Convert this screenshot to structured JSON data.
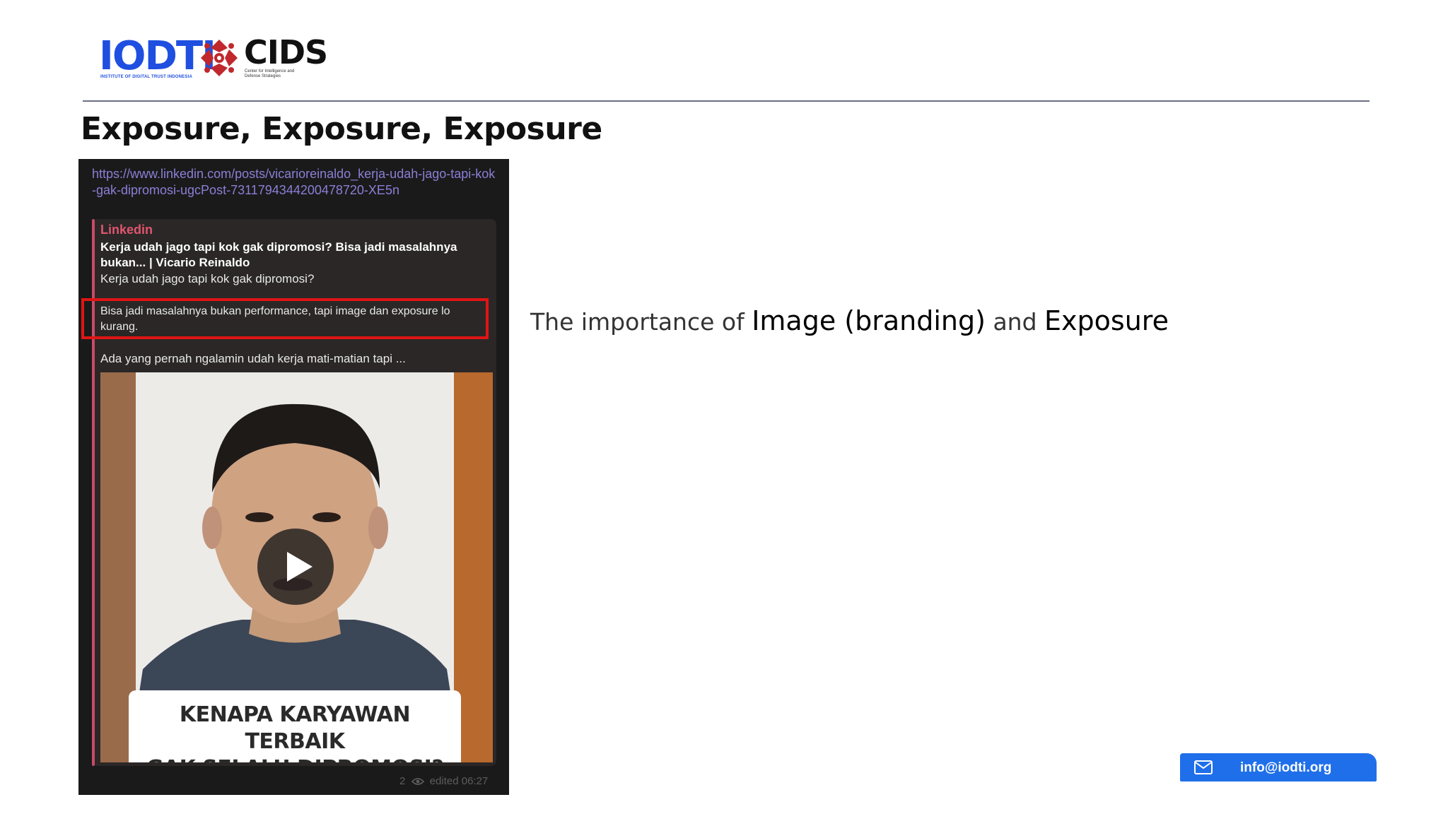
{
  "header": {
    "logo_left_word": "IODTI",
    "logo_left_sub": "INSTITUTE OF DIGITAL TRUST INDONESIA",
    "logo_right_word": "CIDS",
    "logo_right_sub": "Center for Intelligence and Defense Strategies"
  },
  "slide": {
    "title": "Exposure, Exposure, Exposure"
  },
  "post": {
    "url": "https://www.linkedin.com/posts/vicarioreinaldo_kerja-udah-jago-tapi-kok-gak-dipromosi-ugcPost-7311794344200478720-XE5n",
    "site": "Linkedin",
    "headline": "Kerja udah jago tapi kok gak dipromosi? Bisa jadi masalahnya bukan... | Vicario Reinaldo",
    "desc1": "Kerja udah jago tapi kok gak dipromosi?",
    "desc2": "Bisa jadi masalahnya bukan performance, tapi image dan exposure lo kurang.",
    "desc3": "Ada yang pernah ngalamin udah kerja mati-matian tapi ...",
    "video_caption_line1": "KENAPA KARYAWAN TERBAIK",
    "video_caption_line2": "GAK SELALU DIPROMOSI?",
    "views": "2",
    "edited": "edited 06:27"
  },
  "body_text": {
    "prefix": "The importance of ",
    "term1": "Image (branding)",
    "middle": " and ",
    "term2": "Exposure"
  },
  "footer": {
    "email": "info@iodti.org"
  },
  "colors": {
    "brand_blue": "#1f4fe0",
    "cids_red": "#c0282d",
    "highlight_red": "#e01515",
    "email_badge": "#1f6fea"
  },
  "icons": [
    "cids-mark-icon",
    "play-icon",
    "eye-icon",
    "mail-icon"
  ]
}
